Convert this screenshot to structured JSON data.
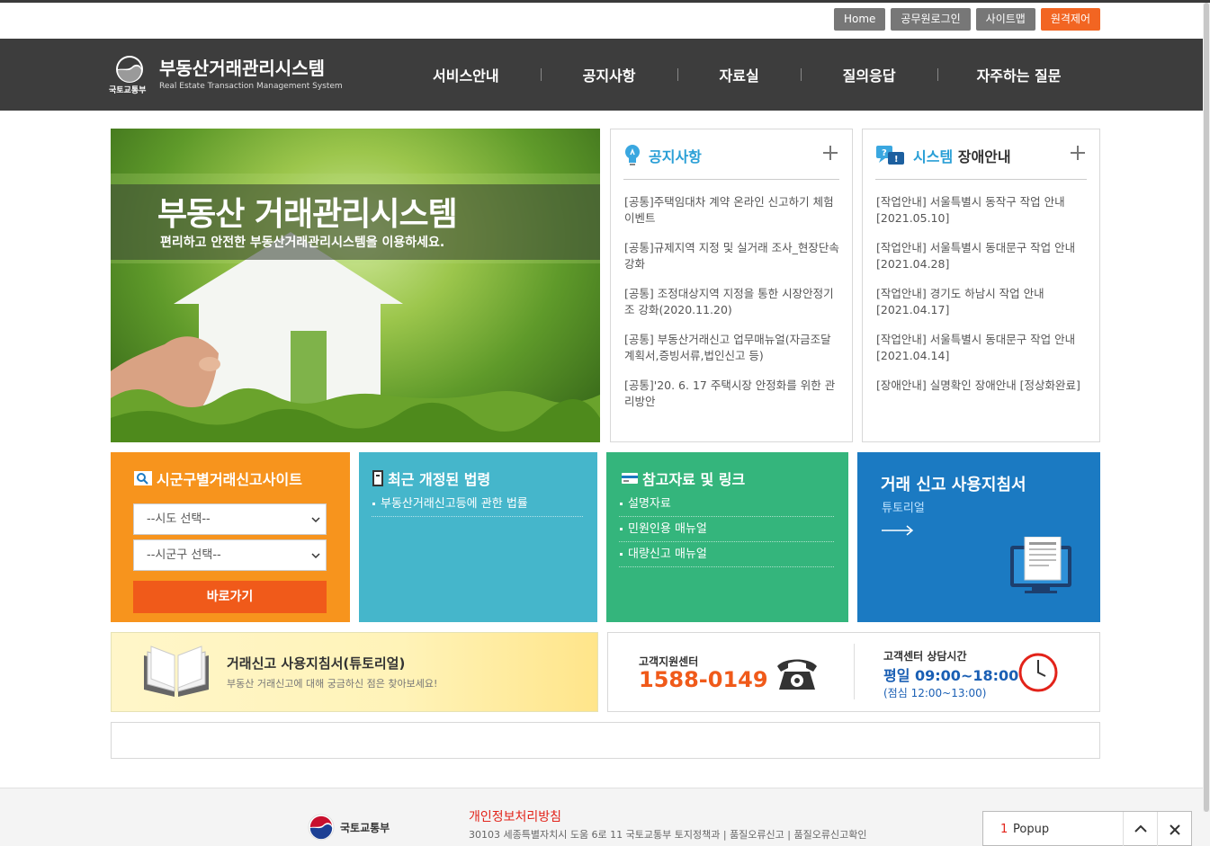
{
  "utility": {
    "home": "Home",
    "login": "공무원로그인",
    "sitemap": "사이트맵",
    "remote": "원격제어"
  },
  "brand": {
    "title": "부동산거래관리시스템",
    "subtitle": "Real Estate Transaction Management System",
    "ministry": "국토교통부"
  },
  "nav": [
    "서비스안내",
    "공지사항",
    "자료실",
    "질의응답",
    "자주하는 질문"
  ],
  "hero": {
    "title": "부동산 거래관리시스템",
    "subtitle": "편리하고 안전한 부동산거래관리시스템을 이용하세요."
  },
  "notice": {
    "title": "공지사항",
    "items": [
      "[공통]주택임대차 계약 온라인 신고하기 체험 이벤트",
      "[공통]규제지역 지정 및 실거래 조사_현장단속 강화",
      "[공통] 조정대상지역 지정을 통한 시장안정기조 강화(2020.11.20)",
      "[공통] 부동산거래신고 업무매뉴얼(자금조달계획서,증빙서류,법인신고 등)",
      "[공통]'20. 6. 17 주택시장 안정화를 위한 관리방안"
    ]
  },
  "fault": {
    "title_blue": "시스템",
    "title_dark": " 장애안내",
    "items": [
      "[작업안내] 서울특별시 동작구 작업 안내[2021.05.10]",
      "[작업안내] 서울특별시 동대문구 작업 안내[2021.04.28]",
      "[작업안내] 경기도 하남시 작업 안내[2021.04.17]",
      "[작업안내] 서울특별시 동대문구 작업 안내[2021.04.14]",
      "[장애안내] 실명확인 장애안내 [정상화완료]"
    ]
  },
  "regional": {
    "title": "시군구별거래신고사이트",
    "sido_placeholder": "--시도 선택--",
    "sigungu_placeholder": "--시군구 선택--",
    "go": "바로가기"
  },
  "laws": {
    "title": "최근 개정된 법령",
    "items": [
      "부동산거래신고등에 관한 법률"
    ]
  },
  "refs": {
    "title": "참고자료 및 링크",
    "items": [
      "설명자료",
      "민원인용 매뉴얼",
      "대량신고 매뉴얼"
    ]
  },
  "guide": {
    "title": "거래 신고 사용지침서",
    "sub": "튜토리얼"
  },
  "banner": {
    "title": "거래신고 사용지침서(튜토리얼)",
    "sub": "부동산 거래신고에 대해 궁금하신 점은 찾아보세요!"
  },
  "contact": {
    "label": "고객지원센터",
    "phone": "1588-0149",
    "hours_label": "고객센터 상담시간",
    "hours": "평일 09:00~18:00",
    "lunch": "(점심 12:00~13:00)"
  },
  "footer": {
    "ministry": "국토교통부",
    "privacy": "개인정보처리방침",
    "address": "30103 세종특별자치시 도움 6로 11 국토교통부 토지정책과 | 품질오류신고 | 품질오류신고확인"
  },
  "popup": {
    "count": "1",
    "label": "Popup"
  },
  "colors": {
    "accent": "#f26522",
    "header": "#3d3d3d",
    "notice_blue": "#2a9fd6",
    "tile_orange": "#f7941d",
    "tile_cyan": "#45b6cb",
    "tile_green": "#34b57c",
    "tile_blue": "#1b7ac2",
    "phone_orange": "#f05a1a"
  }
}
